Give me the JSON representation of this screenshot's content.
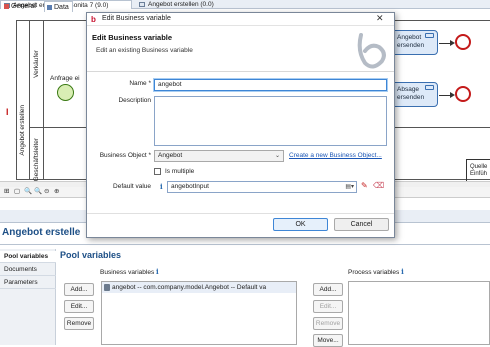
{
  "editor_tabs": [
    {
      "label": "Angebot erstellen - Bonita 7 (9.0)"
    },
    {
      "label": "Angebot erstellen (0.0)"
    }
  ],
  "diagram": {
    "pool_label": "Angebot erstellen",
    "lanes": [
      "Verkäufer",
      "Geschäftsleiter"
    ],
    "start_event_label": "Anfrage ei",
    "tasks": [
      {
        "label_line1": "Angebot",
        "label_line2": "ersenden"
      },
      {
        "label_line1": "Absage",
        "label_line2": "ersenden"
      }
    ],
    "partial_label_line1": "Quelle",
    "partial_label_line2": "Einfüh",
    "marker": "I"
  },
  "zoom_icons": [
    "⊞",
    "▢",
    "🔍",
    "🔍",
    "⊝",
    "⊕"
  ],
  "property_tabs": [
    {
      "label": "General",
      "active": false
    },
    {
      "label": "Data",
      "active": true
    }
  ],
  "page_title": "Angebot erstelle",
  "sidenav": [
    "Pool variables",
    "Documents",
    "Parameters"
  ],
  "section_title": "Pool variables",
  "business_vars": {
    "label": "Business variables",
    "buttons": [
      "Add...",
      "Edit...",
      "Remove"
    ],
    "rows": [
      "angebot -- com.company.model.Angebot -- Default va"
    ]
  },
  "process_vars": {
    "label": "Process variables",
    "buttons": [
      "Add...",
      "Edit...",
      "Remove",
      "Move..."
    ]
  },
  "info_glyph": "i",
  "dialog": {
    "window_title": "Edit Business variable",
    "header_title": "Edit Business variable",
    "header_subtitle": "Edit an existing Business variable",
    "name_label": "Name *",
    "name_value": "angebot",
    "description_label": "Description",
    "description_value": "",
    "bo_label": "Business Object *",
    "bo_value": "Angebot",
    "create_link": "Create a new Business Object...",
    "multiple_label": "Is multiple",
    "default_label": "Default value",
    "default_value": "angebotInput",
    "ok_label": "OK",
    "cancel_label": "Cancel",
    "close_glyph": "✕",
    "logo_glyph": "b"
  },
  "colors": {
    "accent": "#1d4f86",
    "link": "#1a55b5",
    "end_event": "#c41a1a",
    "task_border": "#3a6fb0",
    "focus": "#3e86d6"
  }
}
